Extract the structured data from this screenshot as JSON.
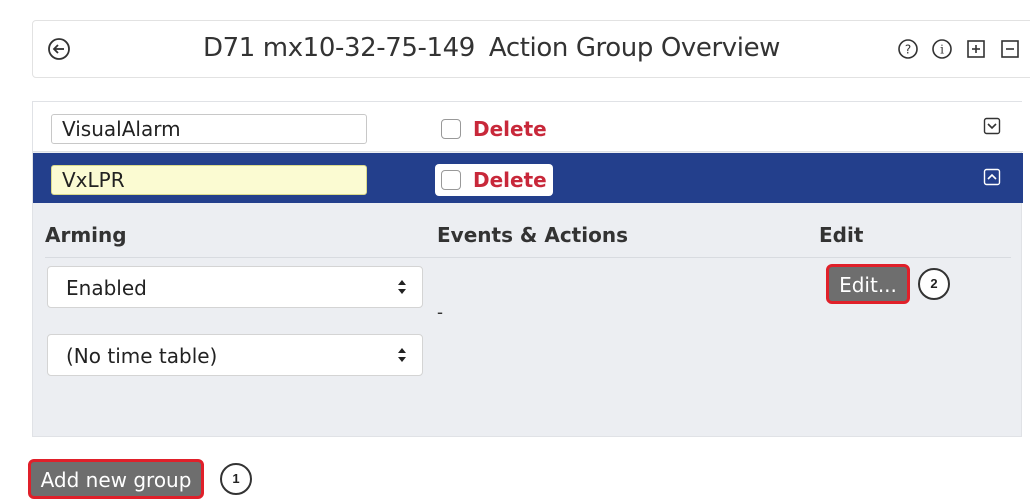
{
  "header": {
    "camera_name": "D71 mx10-32-75-149",
    "page_title": "Action Group Overview",
    "icons": [
      "back-icon",
      "help-icon",
      "info-icon",
      "expand-all-icon",
      "collapse-all-icon"
    ]
  },
  "groups": [
    {
      "name": "VisualAlarm",
      "delete_label": "Delete",
      "expanded": false
    },
    {
      "name": "VxLPR",
      "delete_label": "Delete",
      "expanded": true
    }
  ],
  "details": {
    "col_arming": "Arming",
    "col_events": "Events & Actions",
    "col_edit": "Edit",
    "arming_value": "Enabled",
    "timetable_value": "(No time table)",
    "events_value": "-",
    "edit_label": "Edit...",
    "edit_badge": "2"
  },
  "footer": {
    "add_label": "Add new group",
    "add_badge": "1"
  },
  "colors": {
    "selected_row": "#233f8c",
    "delete_text": "#c8283a",
    "highlight_border": "#e0202a",
    "button_bg": "#6e6e6e"
  }
}
